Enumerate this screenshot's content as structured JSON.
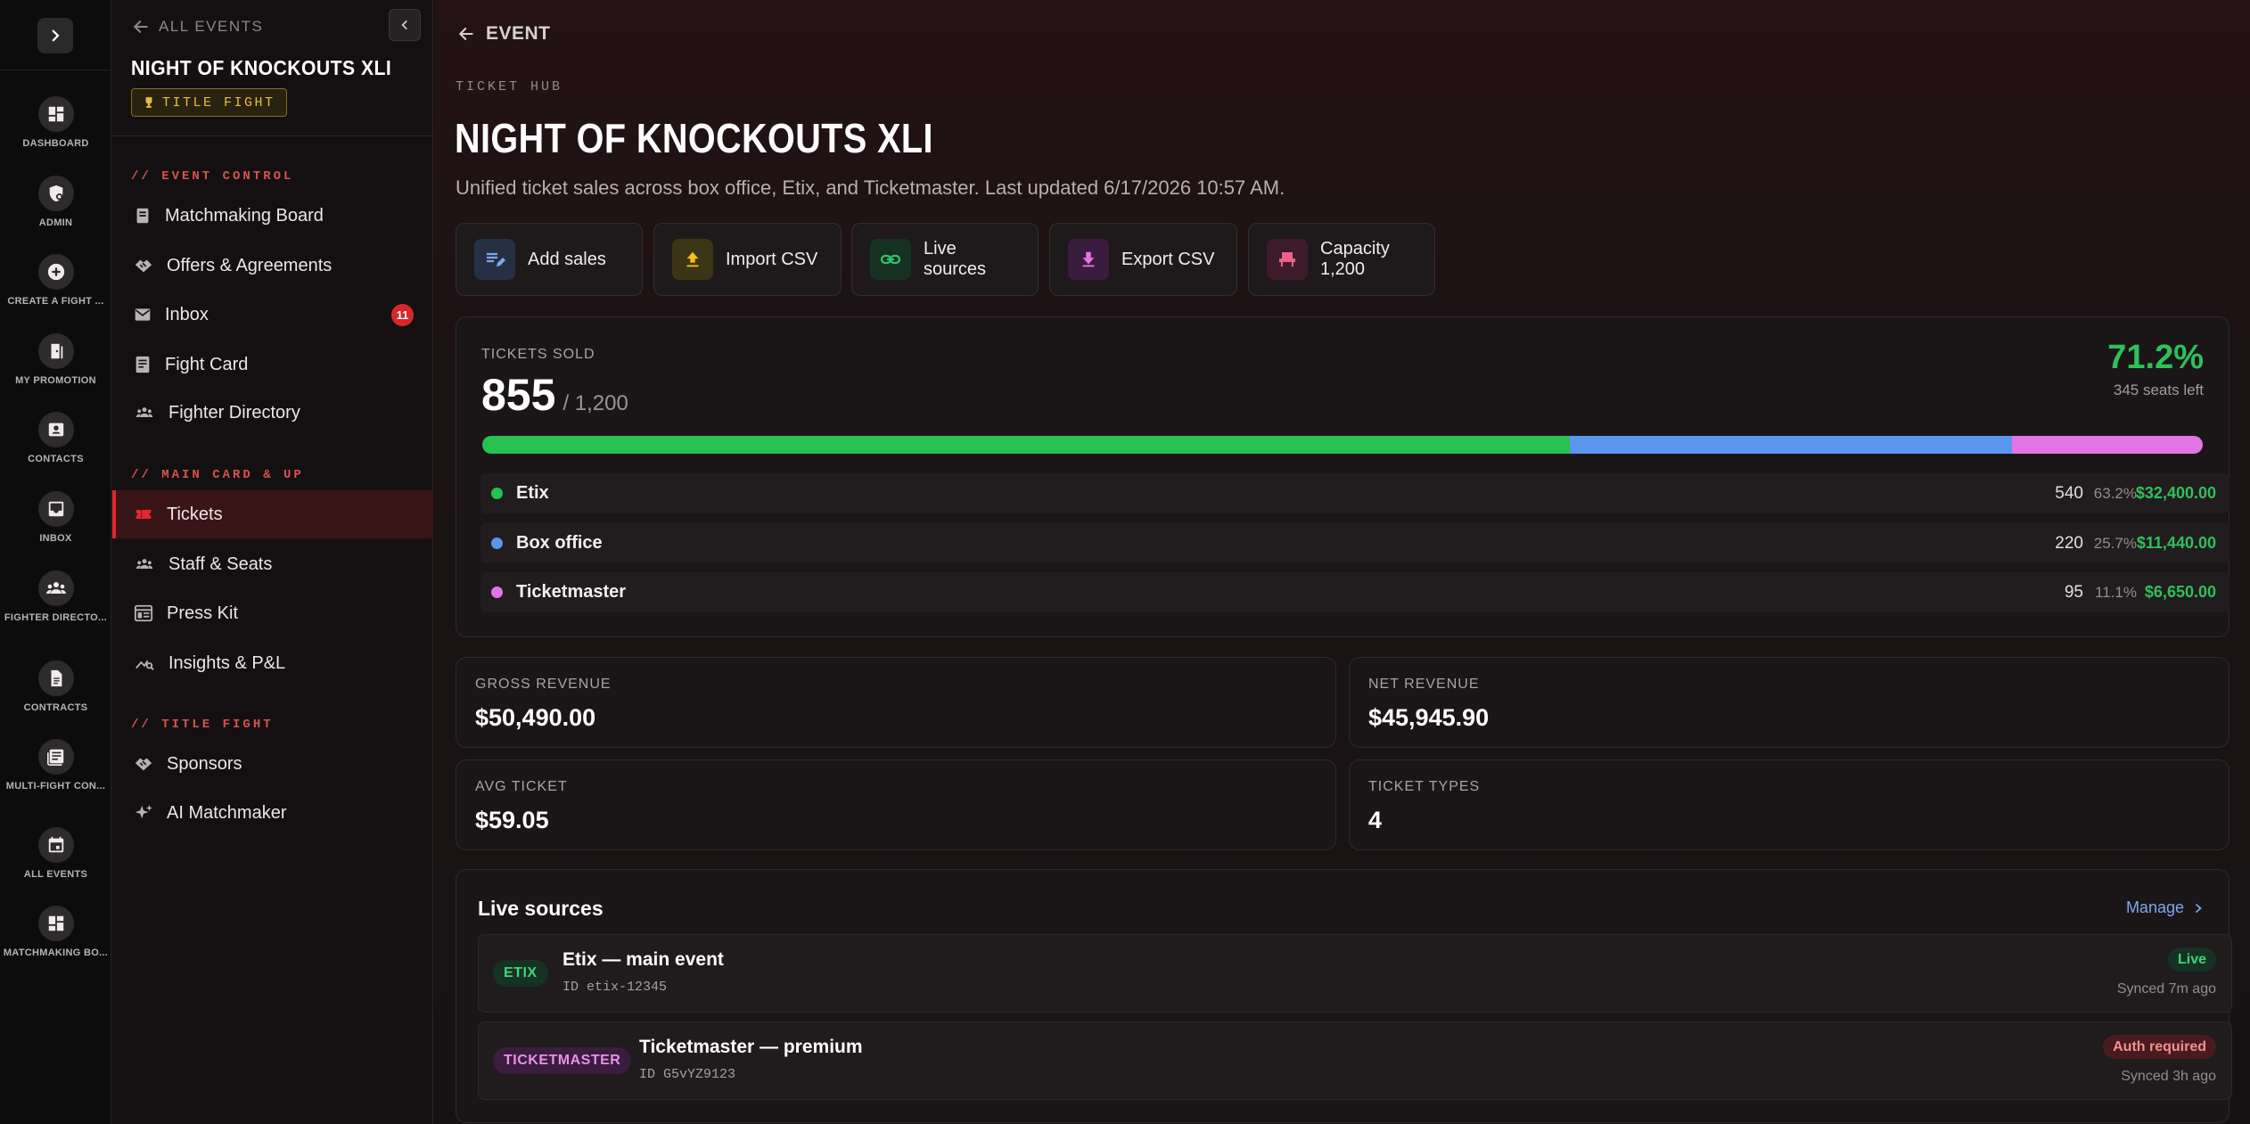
{
  "rail": {
    "items": [
      {
        "label": "DASHBOARD",
        "icon": "dashboard-icon"
      },
      {
        "label": "ADMIN",
        "icon": "admin-shield-icon"
      },
      {
        "label": "CREATE A FIGHT ...",
        "icon": "plus-circle-icon"
      },
      {
        "label": "MY PROMOTION",
        "icon": "door-icon"
      },
      {
        "label": "CONTACTS",
        "icon": "contacts-icon"
      },
      {
        "label": "INBOX",
        "icon": "inbox-icon"
      },
      {
        "label": "FIGHTER DIRECTO...",
        "icon": "group-icon"
      },
      {
        "label": "CONTRACTS",
        "icon": "document-icon"
      },
      {
        "label": "MULTI-FIGHT CON...",
        "icon": "newspaper-icon"
      },
      {
        "label": "ALL EVENTS",
        "icon": "calendar-icon"
      },
      {
        "label": "MATCHMAKING BO...",
        "icon": "dashboard-icon"
      }
    ]
  },
  "sidebar": {
    "back_label": "ALL EVENTS",
    "event_title": "NIGHT OF KNOCKOUTS XLI",
    "event_badge": "TITLE FIGHT",
    "sections": [
      {
        "heading": "// EVENT CONTROL",
        "items": [
          {
            "label": "Matchmaking Board",
            "icon": "board-icon"
          },
          {
            "label": "Offers & Agreements",
            "icon": "handshake-icon"
          },
          {
            "label": "Inbox",
            "icon": "mail-icon",
            "count": "11"
          },
          {
            "label": "Fight Card",
            "icon": "card-icon"
          },
          {
            "label": "Fighter Directory",
            "icon": "group-icon"
          }
        ]
      },
      {
        "heading": "// MAIN CARD & UP",
        "items": [
          {
            "label": "Tickets",
            "icon": "ticket-icon",
            "active": true
          },
          {
            "label": "Staff & Seats",
            "icon": "group-icon"
          },
          {
            "label": "Press Kit",
            "icon": "press-icon"
          },
          {
            "label": "Insights & P&L",
            "icon": "insights-icon"
          }
        ]
      },
      {
        "heading": "// TITLE FIGHT",
        "items": [
          {
            "label": "Sponsors",
            "icon": "handshake-icon"
          },
          {
            "label": "AI Matchmaker",
            "icon": "sparkle-icon"
          }
        ]
      }
    ]
  },
  "main": {
    "back_label": "EVENT",
    "kicker": "TICKET HUB",
    "title": "NIGHT OF KNOCKOUTS XLI",
    "subtitle": "Unified ticket sales across box office, Etix, and Ticketmaster. Last updated 6/17/2026 10:57 AM.",
    "actions": [
      {
        "label": "Add sales",
        "icon": "edit-list-icon"
      },
      {
        "label": "Import CSV",
        "icon": "upload-icon"
      },
      {
        "label_line1": "Live",
        "label_line2": "sources",
        "icon": "link-icon"
      },
      {
        "label": "Export CSV",
        "icon": "download-icon"
      },
      {
        "label_line1": "Capacity",
        "label_line2": "1,200",
        "icon": "seat-icon"
      }
    ],
    "tickets": {
      "label": "TICKETS SOLD",
      "sold": "855",
      "capacity": "/ 1,200",
      "percent": "71.2%",
      "seats_left": "345 seats left",
      "bar_fractions": [
        0.632,
        0.257,
        0.111
      ],
      "bar_colors": [
        "#27c152",
        "#5b96ee",
        "#e374e4"
      ],
      "sources": [
        {
          "name": "Etix",
          "count": "540",
          "pct": "63.2%",
          "amount": "$32,400.00",
          "color": "#27c152"
        },
        {
          "name": "Box office",
          "count": "220",
          "pct": "25.7%",
          "amount": "$11,440.00",
          "color": "#5b96ee"
        },
        {
          "name": "Ticketmaster",
          "count": "95",
          "pct": "11.1%",
          "amount": "$6,650.00",
          "color": "#e374e4"
        }
      ]
    },
    "stats": [
      {
        "label": "GROSS REVENUE",
        "value": "$50,490.00"
      },
      {
        "label": "NET REVENUE",
        "value": "$45,945.90"
      },
      {
        "label": "AVG TICKET",
        "value": "$59.05"
      },
      {
        "label": "TICKET TYPES",
        "value": "4"
      }
    ],
    "live": {
      "title": "Live sources",
      "manage_label": "Manage",
      "rows": [
        {
          "tag": "ETIX",
          "name": "Etix — main event",
          "id": "ID etix-12345",
          "status": "Live",
          "synced": "Synced 7m ago"
        },
        {
          "tag": "TICKETMASTER",
          "name": "Ticketmaster — premium",
          "id": "ID G5vYZ9123",
          "status": "Auth required",
          "synced": "Synced 3h ago"
        }
      ]
    }
  }
}
